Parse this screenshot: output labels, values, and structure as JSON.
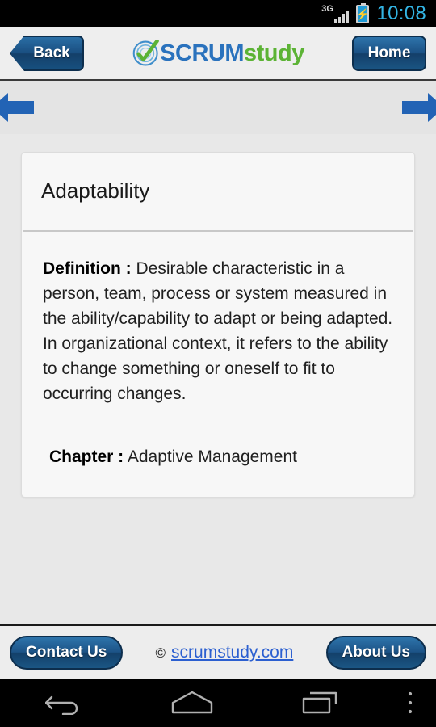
{
  "status_bar": {
    "network_type": "3G",
    "signal_icon": "signal-bars-icon",
    "battery_icon": "battery-charging-icon",
    "clock": "10:08"
  },
  "header": {
    "back_label": "Back",
    "home_label": "Home",
    "logo": {
      "mark_icon": "scrumstudy-check-swirl-icon",
      "text_primary": "SCRUM",
      "text_secondary": "study",
      "color_primary": "#2a72bd",
      "color_secondary": "#5cb335"
    }
  },
  "nav_arrows": {
    "previous_icon": "arrow-left-icon",
    "next_icon": "arrow-right-icon",
    "color": "#2263b5"
  },
  "card": {
    "title": "Adaptability",
    "definition_label": "Definition :",
    "definition_text": " Desirable characteristic in a person, team, process or system measured in the ability/capability to adapt or being adapted. In organizational context, it refers to the ability to change something or oneself to fit to occurring changes.",
    "chapter_label": "Chapter :",
    "chapter_value": " Adaptive Management"
  },
  "footer": {
    "contact_label": "Contact Us",
    "about_label": "About Us",
    "copyright_symbol": "©",
    "site_link": "scrumstudy.com",
    "link_color": "#2b5fd0"
  },
  "android_navbar": {
    "back_icon": "back-arrow-icon",
    "home_icon": "home-icon",
    "recents_icon": "recent-apps-icon",
    "overflow_icon": "overflow-menu-icon"
  }
}
